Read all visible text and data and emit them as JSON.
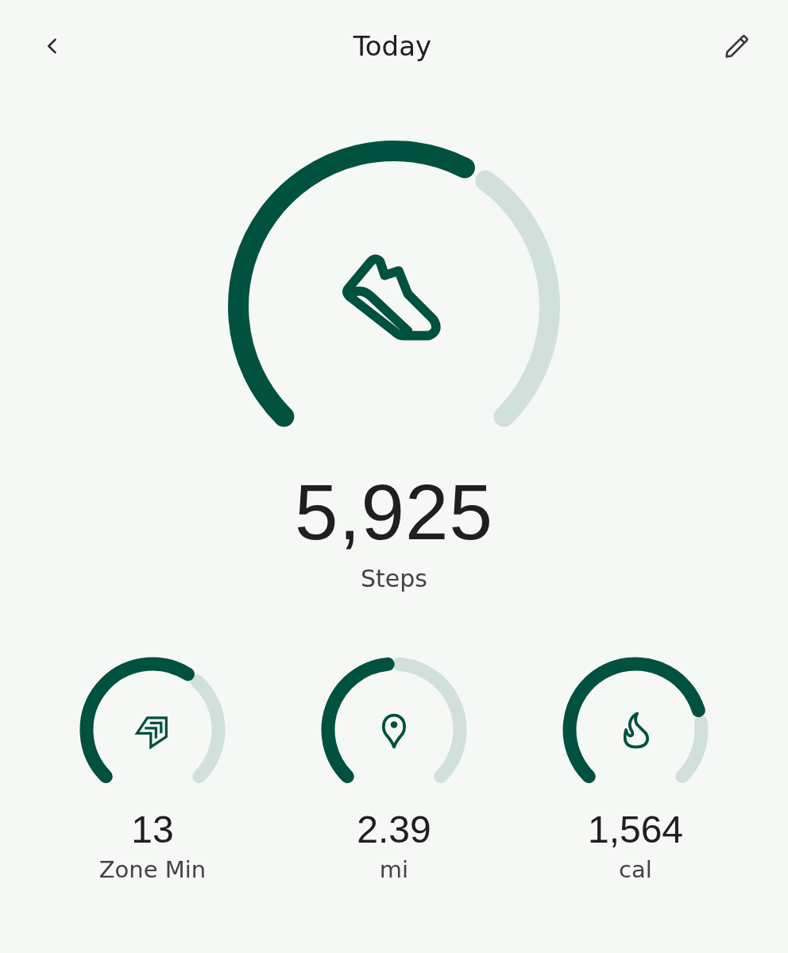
{
  "header": {
    "title": "Today"
  },
  "main": {
    "kind": "steps",
    "value": "5,925",
    "label": "Steps"
  },
  "metrics": [
    {
      "kind": "zone",
      "value": "13",
      "label": "Zone Min"
    },
    {
      "kind": "distance",
      "value": "2.39",
      "label": "mi"
    },
    {
      "kind": "calories",
      "value": "1,564",
      "label": "cal"
    }
  ]
}
